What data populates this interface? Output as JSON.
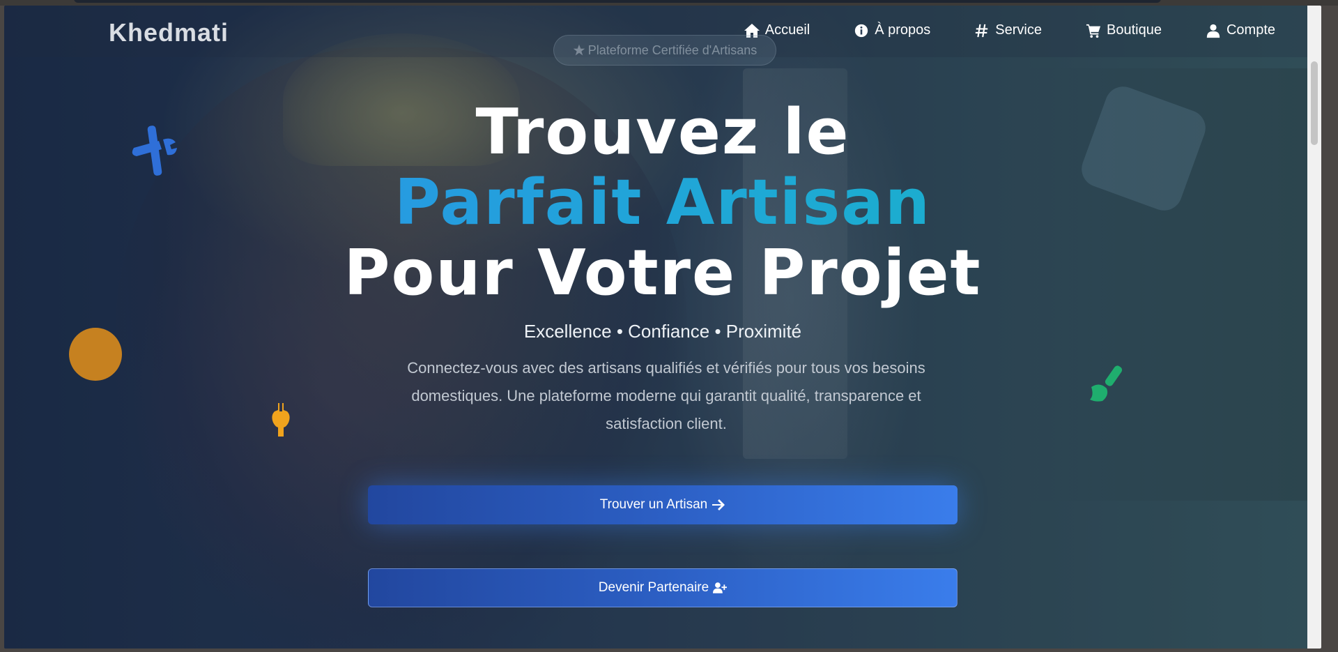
{
  "brand": "Khedmati",
  "nav": {
    "items": [
      {
        "label": "Accueil",
        "icon": "home-icon"
      },
      {
        "label": "À propos",
        "icon": "info-icon"
      },
      {
        "label": "Service",
        "icon": "hashtag-icon"
      },
      {
        "label": "Boutique",
        "icon": "cart-icon"
      },
      {
        "label": "Compte",
        "icon": "user-icon"
      }
    ]
  },
  "badge": {
    "label": "Plateforme Certifiée d'Artisans",
    "icon": "star-icon"
  },
  "hero": {
    "line1": "Trouvez le",
    "line2": "Parfait Artisan",
    "line3": "Pour Votre Projet",
    "tagline": "Excellence • Confiance • Proximité",
    "description": "Connectez-vous avec des artisans qualifiés et vérifiés pour tous vos besoins domestiques. Une plateforme moderne qui garantit qualité, transparence et satisfaction client."
  },
  "buttons": {
    "primary": {
      "label": "Trouver un Artisan",
      "icon": "arrow-right-icon"
    },
    "secondary": {
      "label": "Devenir Partenaire",
      "icon": "user-plus-icon"
    }
  },
  "colors": {
    "accent_blue": "#3b82f6",
    "gradient_start": "#2e8cec",
    "gradient_end": "#14b5c2",
    "deco_orange": "#d98b1c",
    "deco_green": "#1fae6e",
    "deco_blue": "#2f6fd8"
  }
}
